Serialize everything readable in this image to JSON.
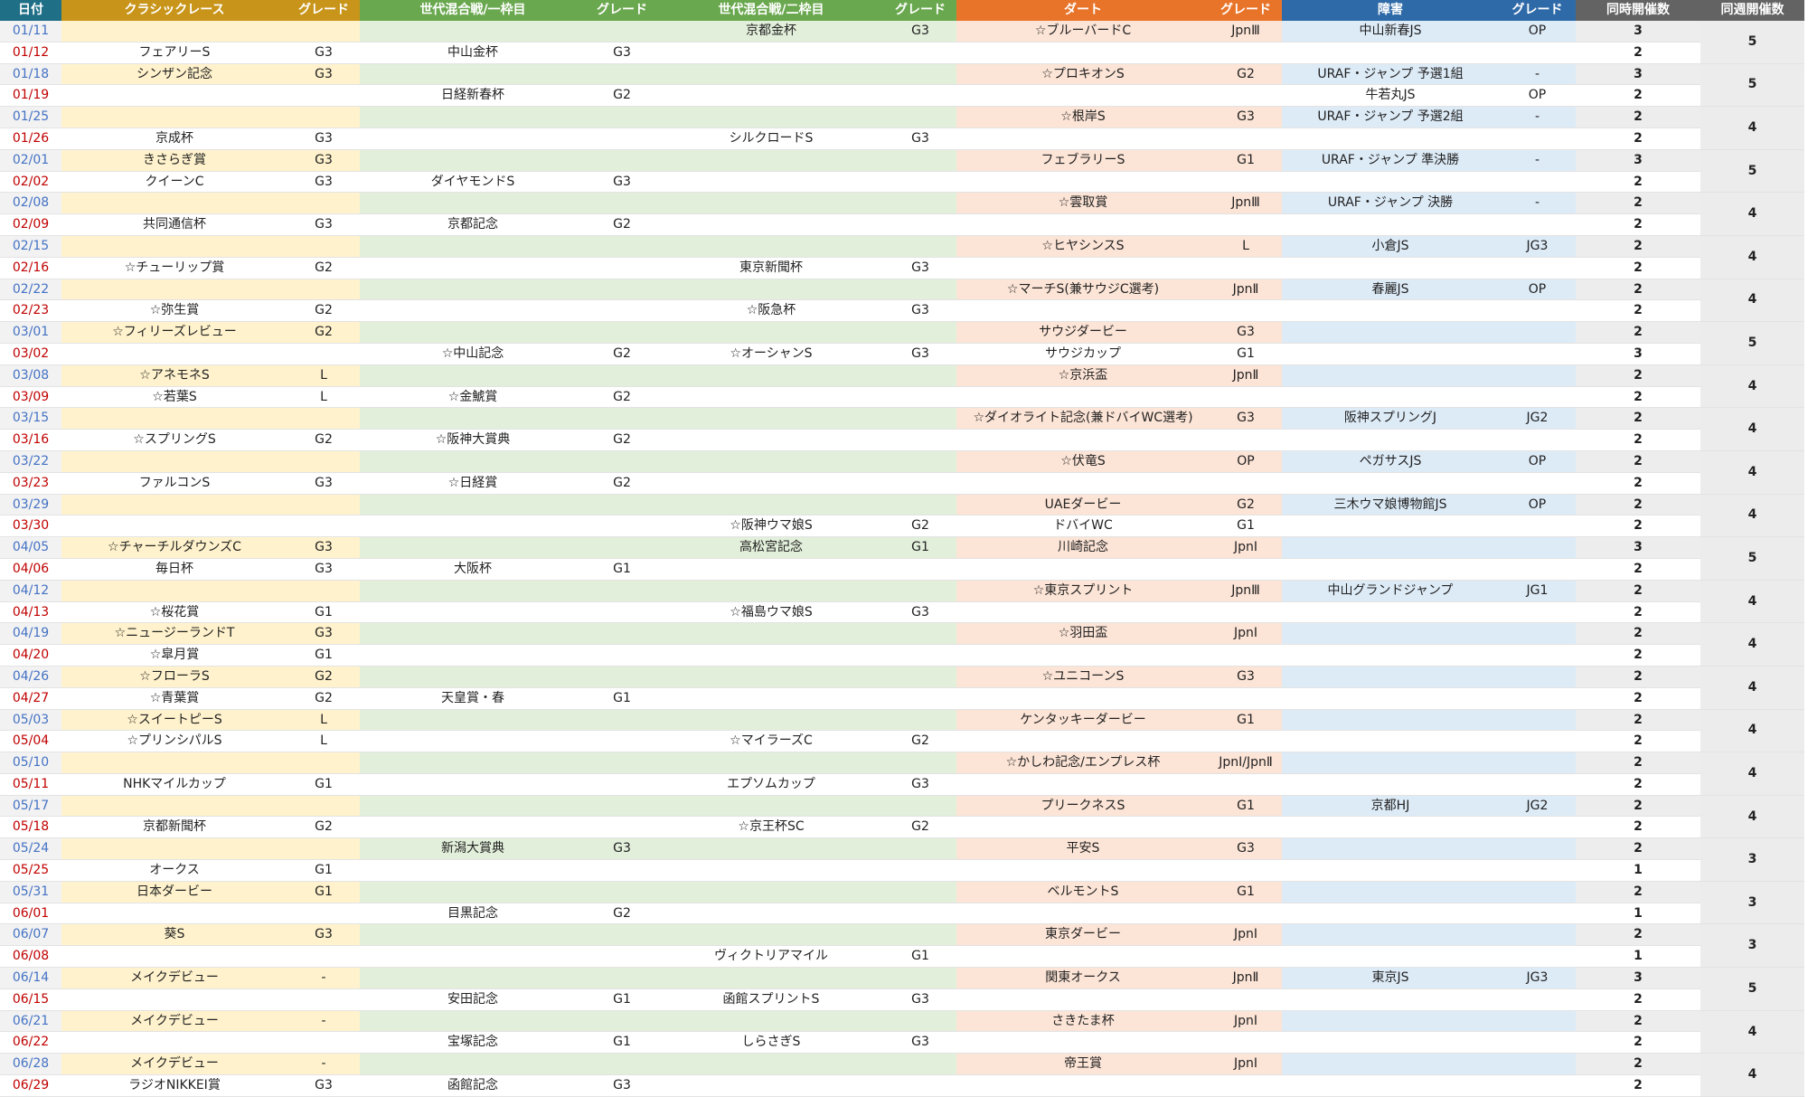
{
  "headers": {
    "date": "日付",
    "classic": "クラシックレース",
    "classic_grade": "グレード",
    "mix1": "世代混合戦/一枠目",
    "mix1_grade": "グレード",
    "mix2": "世代混合戦/二枠目",
    "mix2_grade": "グレード",
    "dirt": "ダート",
    "dirt_grade": "グレード",
    "jump": "障害",
    "jump_grade": "グレード",
    "simul": "同時開催数",
    "week": "同週開催数"
  },
  "colors": {
    "header_date": "#1f6f86",
    "header_classic": "#c8951a",
    "header_mix": "#6aa84f",
    "header_dirt": "#e8742a",
    "header_jump": "#2f6aa8",
    "header_count": "#636363",
    "saturday_date": "#4472c4",
    "sunday_date": "#c00000"
  },
  "rows": [
    {
      "date": "01/11",
      "classic": "",
      "classic_grade": "",
      "mix1": "",
      "mix1_grade": "",
      "mix2": "京都金杯",
      "mix2_grade": "G3",
      "dirt": "☆ブルーバードC",
      "dirt_grade": "JpnⅢ",
      "jump": "中山新春JS",
      "jump_grade": "OP",
      "simul": "3"
    },
    {
      "date": "01/12",
      "classic": "フェアリーS",
      "classic_grade": "G3",
      "mix1": "中山金杯",
      "mix1_grade": "G3",
      "mix2": "",
      "mix2_grade": "",
      "dirt": "",
      "dirt_grade": "",
      "jump": "",
      "jump_grade": "",
      "simul": "2"
    },
    {
      "date": "01/18",
      "classic": "シンザン記念",
      "classic_grade": "G3",
      "mix1": "",
      "mix1_grade": "",
      "mix2": "",
      "mix2_grade": "",
      "dirt": "☆プロキオンS",
      "dirt_grade": "G2",
      "jump": "URAF・ジャンプ 予選1組",
      "jump_grade": "-",
      "simul": "3"
    },
    {
      "date": "01/19",
      "classic": "",
      "classic_grade": "",
      "mix1": "日経新春杯",
      "mix1_grade": "G2",
      "mix2": "",
      "mix2_grade": "",
      "dirt": "",
      "dirt_grade": "",
      "jump": "牛若丸JS",
      "jump_grade": "OP",
      "simul": "2"
    },
    {
      "date": "01/25",
      "classic": "",
      "classic_grade": "",
      "mix1": "",
      "mix1_grade": "",
      "mix2": "",
      "mix2_grade": "",
      "dirt": "☆根岸S",
      "dirt_grade": "G3",
      "jump": "URAF・ジャンプ 予選2組",
      "jump_grade": "-",
      "simul": "2"
    },
    {
      "date": "01/26",
      "classic": "京成杯",
      "classic_grade": "G3",
      "mix1": "",
      "mix1_grade": "",
      "mix2": "シルクロードS",
      "mix2_grade": "G3",
      "dirt": "",
      "dirt_grade": "",
      "jump": "",
      "jump_grade": "",
      "simul": "2"
    },
    {
      "date": "02/01",
      "classic": "きさらぎ賞",
      "classic_grade": "G3",
      "mix1": "",
      "mix1_grade": "",
      "mix2": "",
      "mix2_grade": "",
      "dirt": "フェブラリーS",
      "dirt_grade": "G1",
      "jump": "URAF・ジャンプ 準決勝",
      "jump_grade": "-",
      "simul": "3"
    },
    {
      "date": "02/02",
      "classic": "クイーンC",
      "classic_grade": "G3",
      "mix1": "ダイヤモンドS",
      "mix1_grade": "G3",
      "mix2": "",
      "mix2_grade": "",
      "dirt": "",
      "dirt_grade": "",
      "jump": "",
      "jump_grade": "",
      "simul": "2"
    },
    {
      "date": "02/08",
      "classic": "",
      "classic_grade": "",
      "mix1": "",
      "mix1_grade": "",
      "mix2": "",
      "mix2_grade": "",
      "dirt": "☆雲取賞",
      "dirt_grade": "JpnⅢ",
      "jump": "URAF・ジャンプ 決勝",
      "jump_grade": "-",
      "simul": "2"
    },
    {
      "date": "02/09",
      "classic": "共同通信杯",
      "classic_grade": "G3",
      "mix1": "京都記念",
      "mix1_grade": "G2",
      "mix2": "",
      "mix2_grade": "",
      "dirt": "",
      "dirt_grade": "",
      "jump": "",
      "jump_grade": "",
      "simul": "2"
    },
    {
      "date": "02/15",
      "classic": "",
      "classic_grade": "",
      "mix1": "",
      "mix1_grade": "",
      "mix2": "",
      "mix2_grade": "",
      "dirt": "☆ヒヤシンスS",
      "dirt_grade": "L",
      "jump": "小倉JS",
      "jump_grade": "JG3",
      "simul": "2"
    },
    {
      "date": "02/16",
      "classic": "☆チューリップ賞",
      "classic_grade": "G2",
      "mix1": "",
      "mix1_grade": "",
      "mix2": "東京新聞杯",
      "mix2_grade": "G3",
      "dirt": "",
      "dirt_grade": "",
      "jump": "",
      "jump_grade": "",
      "simul": "2"
    },
    {
      "date": "02/22",
      "classic": "",
      "classic_grade": "",
      "mix1": "",
      "mix1_grade": "",
      "mix2": "",
      "mix2_grade": "",
      "dirt": "☆マーチS(兼サウジC選考)",
      "dirt_grade": "JpnⅡ",
      "jump": "春麗JS",
      "jump_grade": "OP",
      "simul": "2"
    },
    {
      "date": "02/23",
      "classic": "☆弥生賞",
      "classic_grade": "G2",
      "mix1": "",
      "mix1_grade": "",
      "mix2": "☆阪急杯",
      "mix2_grade": "G3",
      "dirt": "",
      "dirt_grade": "",
      "jump": "",
      "jump_grade": "",
      "simul": "2"
    },
    {
      "date": "03/01",
      "classic": "☆フィリーズレビュー",
      "classic_grade": "G2",
      "mix1": "",
      "mix1_grade": "",
      "mix2": "",
      "mix2_grade": "",
      "dirt": "サウジダービー",
      "dirt_grade": "G3",
      "jump": "",
      "jump_grade": "",
      "simul": "2"
    },
    {
      "date": "03/02",
      "classic": "",
      "classic_grade": "",
      "mix1": "☆中山記念",
      "mix1_grade": "G2",
      "mix2": "☆オーシャンS",
      "mix2_grade": "G3",
      "dirt": "サウジカップ",
      "dirt_grade": "G1",
      "jump": "",
      "jump_grade": "",
      "simul": "3"
    },
    {
      "date": "03/08",
      "classic": "☆アネモネS",
      "classic_grade": "L",
      "mix1": "",
      "mix1_grade": "",
      "mix2": "",
      "mix2_grade": "",
      "dirt": "☆京浜盃",
      "dirt_grade": "JpnⅡ",
      "jump": "",
      "jump_grade": "",
      "simul": "2"
    },
    {
      "date": "03/09",
      "classic": "☆若葉S",
      "classic_grade": "L",
      "mix1": "☆金鯱賞",
      "mix1_grade": "G2",
      "mix2": "",
      "mix2_grade": "",
      "dirt": "",
      "dirt_grade": "",
      "jump": "",
      "jump_grade": "",
      "simul": "2"
    },
    {
      "date": "03/15",
      "classic": "",
      "classic_grade": "",
      "mix1": "",
      "mix1_grade": "",
      "mix2": "",
      "mix2_grade": "",
      "dirt": "☆ダイオライト記念(兼ドバイWC選考)",
      "dirt_grade": "G3",
      "jump": "阪神スプリングJ",
      "jump_grade": "JG2",
      "simul": "2"
    },
    {
      "date": "03/16",
      "classic": "☆スプリングS",
      "classic_grade": "G2",
      "mix1": "☆阪神大賞典",
      "mix1_grade": "G2",
      "mix2": "",
      "mix2_grade": "",
      "dirt": "",
      "dirt_grade": "",
      "jump": "",
      "jump_grade": "",
      "simul": "2"
    },
    {
      "date": "03/22",
      "classic": "",
      "classic_grade": "",
      "mix1": "",
      "mix1_grade": "",
      "mix2": "",
      "mix2_grade": "",
      "dirt": "☆伏竜S",
      "dirt_grade": "OP",
      "jump": "ペガサスJS",
      "jump_grade": "OP",
      "simul": "2"
    },
    {
      "date": "03/23",
      "classic": "ファルコンS",
      "classic_grade": "G3",
      "mix1": "☆日経賞",
      "mix1_grade": "G2",
      "mix2": "",
      "mix2_grade": "",
      "dirt": "",
      "dirt_grade": "",
      "jump": "",
      "jump_grade": "",
      "simul": "2"
    },
    {
      "date": "03/29",
      "classic": "",
      "classic_grade": "",
      "mix1": "",
      "mix1_grade": "",
      "mix2": "",
      "mix2_grade": "",
      "dirt": "UAEダービー",
      "dirt_grade": "G2",
      "jump": "三木ウマ娘博物館JS",
      "jump_grade": "OP",
      "simul": "2"
    },
    {
      "date": "03/30",
      "classic": "",
      "classic_grade": "",
      "mix1": "",
      "mix1_grade": "",
      "mix2": "☆阪神ウマ娘S",
      "mix2_grade": "G2",
      "dirt": "ドバイWC",
      "dirt_grade": "G1",
      "jump": "",
      "jump_grade": "",
      "simul": "2"
    },
    {
      "date": "04/05",
      "classic": "☆チャーチルダウンズC",
      "classic_grade": "G3",
      "mix1": "",
      "mix1_grade": "",
      "mix2": "高松宮記念",
      "mix2_grade": "G1",
      "dirt": "川崎記念",
      "dirt_grade": "JpnⅠ",
      "jump": "",
      "jump_grade": "",
      "simul": "3"
    },
    {
      "date": "04/06",
      "classic": "毎日杯",
      "classic_grade": "G3",
      "mix1": "大阪杯",
      "mix1_grade": "G1",
      "mix2": "",
      "mix2_grade": "",
      "dirt": "",
      "dirt_grade": "",
      "jump": "",
      "jump_grade": "",
      "simul": "2"
    },
    {
      "date": "04/12",
      "classic": "",
      "classic_grade": "",
      "mix1": "",
      "mix1_grade": "",
      "mix2": "",
      "mix2_grade": "",
      "dirt": "☆東京スプリント",
      "dirt_grade": "JpnⅢ",
      "jump": "中山グランドジャンプ",
      "jump_grade": "JG1",
      "simul": "2"
    },
    {
      "date": "04/13",
      "classic": "☆桜花賞",
      "classic_grade": "G1",
      "mix1": "",
      "mix1_grade": "",
      "mix2": "☆福島ウマ娘S",
      "mix2_grade": "G3",
      "dirt": "",
      "dirt_grade": "",
      "jump": "",
      "jump_grade": "",
      "simul": "2"
    },
    {
      "date": "04/19",
      "classic": "☆ニュージーランドT",
      "classic_grade": "G3",
      "mix1": "",
      "mix1_grade": "",
      "mix2": "",
      "mix2_grade": "",
      "dirt": "☆羽田盃",
      "dirt_grade": "JpnⅠ",
      "jump": "",
      "jump_grade": "",
      "simul": "2"
    },
    {
      "date": "04/20",
      "classic": "☆皐月賞",
      "classic_grade": "G1",
      "mix1": "",
      "mix1_grade": "",
      "mix2": "",
      "mix2_grade": "",
      "dirt": "",
      "dirt_grade": "",
      "jump": "",
      "jump_grade": "",
      "simul": "2"
    },
    {
      "date": "04/26",
      "classic": "☆フローラS",
      "classic_grade": "G2",
      "mix1": "",
      "mix1_grade": "",
      "mix2": "",
      "mix2_grade": "",
      "dirt": "☆ユニコーンS",
      "dirt_grade": "G3",
      "jump": "",
      "jump_grade": "",
      "simul": "2"
    },
    {
      "date": "04/27",
      "classic": "☆青葉賞",
      "classic_grade": "G2",
      "mix1": "天皇賞・春",
      "mix1_grade": "G1",
      "mix2": "",
      "mix2_grade": "",
      "dirt": "",
      "dirt_grade": "",
      "jump": "",
      "jump_grade": "",
      "simul": "2"
    },
    {
      "date": "05/03",
      "classic": "☆スイートピーS",
      "classic_grade": "L",
      "mix1": "",
      "mix1_grade": "",
      "mix2": "",
      "mix2_grade": "",
      "dirt": "ケンタッキーダービー",
      "dirt_grade": "G1",
      "jump": "",
      "jump_grade": "",
      "simul": "2"
    },
    {
      "date": "05/04",
      "classic": "☆プリンシパルS",
      "classic_grade": "L",
      "mix1": "",
      "mix1_grade": "",
      "mix2": "☆マイラーズC",
      "mix2_grade": "G2",
      "dirt": "",
      "dirt_grade": "",
      "jump": "",
      "jump_grade": "",
      "simul": "2"
    },
    {
      "date": "05/10",
      "classic": "",
      "classic_grade": "",
      "mix1": "",
      "mix1_grade": "",
      "mix2": "",
      "mix2_grade": "",
      "dirt": "☆かしわ記念/エンプレス杯",
      "dirt_grade": "JpnⅠ/JpnⅡ",
      "jump": "",
      "jump_grade": "",
      "simul": "2"
    },
    {
      "date": "05/11",
      "classic": "NHKマイルカップ",
      "classic_grade": "G1",
      "mix1": "",
      "mix1_grade": "",
      "mix2": "エプソムカップ",
      "mix2_grade": "G3",
      "dirt": "",
      "dirt_grade": "",
      "jump": "",
      "jump_grade": "",
      "simul": "2"
    },
    {
      "date": "05/17",
      "classic": "",
      "classic_grade": "",
      "mix1": "",
      "mix1_grade": "",
      "mix2": "",
      "mix2_grade": "",
      "dirt": "プリークネスS",
      "dirt_grade": "G1",
      "jump": "京都HJ",
      "jump_grade": "JG2",
      "simul": "2"
    },
    {
      "date": "05/18",
      "classic": "京都新聞杯",
      "classic_grade": "G2",
      "mix1": "",
      "mix1_grade": "",
      "mix2": "☆京王杯SC",
      "mix2_grade": "G2",
      "dirt": "",
      "dirt_grade": "",
      "jump": "",
      "jump_grade": "",
      "simul": "2"
    },
    {
      "date": "05/24",
      "classic": "",
      "classic_grade": "",
      "mix1": "新潟大賞典",
      "mix1_grade": "G3",
      "mix2": "",
      "mix2_grade": "",
      "dirt": "平安S",
      "dirt_grade": "G3",
      "jump": "",
      "jump_grade": "",
      "simul": "2"
    },
    {
      "date": "05/25",
      "classic": "オークス",
      "classic_grade": "G1",
      "mix1": "",
      "mix1_grade": "",
      "mix2": "",
      "mix2_grade": "",
      "dirt": "",
      "dirt_grade": "",
      "jump": "",
      "jump_grade": "",
      "simul": "1"
    },
    {
      "date": "05/31",
      "classic": "日本ダービー",
      "classic_grade": "G1",
      "mix1": "",
      "mix1_grade": "",
      "mix2": "",
      "mix2_grade": "",
      "dirt": "ベルモントS",
      "dirt_grade": "G1",
      "jump": "",
      "jump_grade": "",
      "simul": "2"
    },
    {
      "date": "06/01",
      "classic": "",
      "classic_grade": "",
      "mix1": "目黒記念",
      "mix1_grade": "G2",
      "mix2": "",
      "mix2_grade": "",
      "dirt": "",
      "dirt_grade": "",
      "jump": "",
      "jump_grade": "",
      "simul": "1"
    },
    {
      "date": "06/07",
      "classic": "葵S",
      "classic_grade": "G3",
      "mix1": "",
      "mix1_grade": "",
      "mix2": "",
      "mix2_grade": "",
      "dirt": "東京ダービー",
      "dirt_grade": "JpnⅠ",
      "jump": "",
      "jump_grade": "",
      "simul": "2"
    },
    {
      "date": "06/08",
      "classic": "",
      "classic_grade": "",
      "mix1": "",
      "mix1_grade": "",
      "mix2": "ヴィクトリアマイル",
      "mix2_grade": "G1",
      "dirt": "",
      "dirt_grade": "",
      "jump": "",
      "jump_grade": "",
      "simul": "1"
    },
    {
      "date": "06/14",
      "classic": "メイクデビュー",
      "classic_grade": "-",
      "mix1": "",
      "mix1_grade": "",
      "mix2": "",
      "mix2_grade": "",
      "dirt": "関東オークス",
      "dirt_grade": "JpnⅡ",
      "jump": "東京JS",
      "jump_grade": "JG3",
      "simul": "3"
    },
    {
      "date": "06/15",
      "classic": "",
      "classic_grade": "",
      "mix1": "安田記念",
      "mix1_grade": "G1",
      "mix2": "函館スプリントS",
      "mix2_grade": "G3",
      "dirt": "",
      "dirt_grade": "",
      "jump": "",
      "jump_grade": "",
      "simul": "2"
    },
    {
      "date": "06/21",
      "classic": "メイクデビュー",
      "classic_grade": "-",
      "mix1": "",
      "mix1_grade": "",
      "mix2": "",
      "mix2_grade": "",
      "dirt": "さきたま杯",
      "dirt_grade": "JpnⅠ",
      "jump": "",
      "jump_grade": "",
      "simul": "2"
    },
    {
      "date": "06/22",
      "classic": "",
      "classic_grade": "",
      "mix1": "宝塚記念",
      "mix1_grade": "G1",
      "mix2": "しらさぎS",
      "mix2_grade": "G3",
      "dirt": "",
      "dirt_grade": "",
      "jump": "",
      "jump_grade": "",
      "simul": "2"
    },
    {
      "date": "06/28",
      "classic": "メイクデビュー",
      "classic_grade": "-",
      "mix1": "",
      "mix1_grade": "",
      "mix2": "",
      "mix2_grade": "",
      "dirt": "帝王賞",
      "dirt_grade": "JpnⅠ",
      "jump": "",
      "jump_grade": "",
      "simul": "2"
    },
    {
      "date": "06/29",
      "classic": "ラジオNIKKEI賞",
      "classic_grade": "G3",
      "mix1": "函館記念",
      "mix1_grade": "G3",
      "mix2": "",
      "mix2_grade": "",
      "dirt": "",
      "dirt_grade": "",
      "jump": "",
      "jump_grade": "",
      "simul": "2"
    }
  ],
  "weekly": [
    "5",
    "5",
    "4",
    "5",
    "4",
    "4",
    "4",
    "5",
    "4",
    "4",
    "4",
    "4",
    "5",
    "4",
    "4",
    "4",
    "4",
    "4",
    "4",
    "3",
    "3",
    "3",
    "5",
    "4",
    "4"
  ]
}
